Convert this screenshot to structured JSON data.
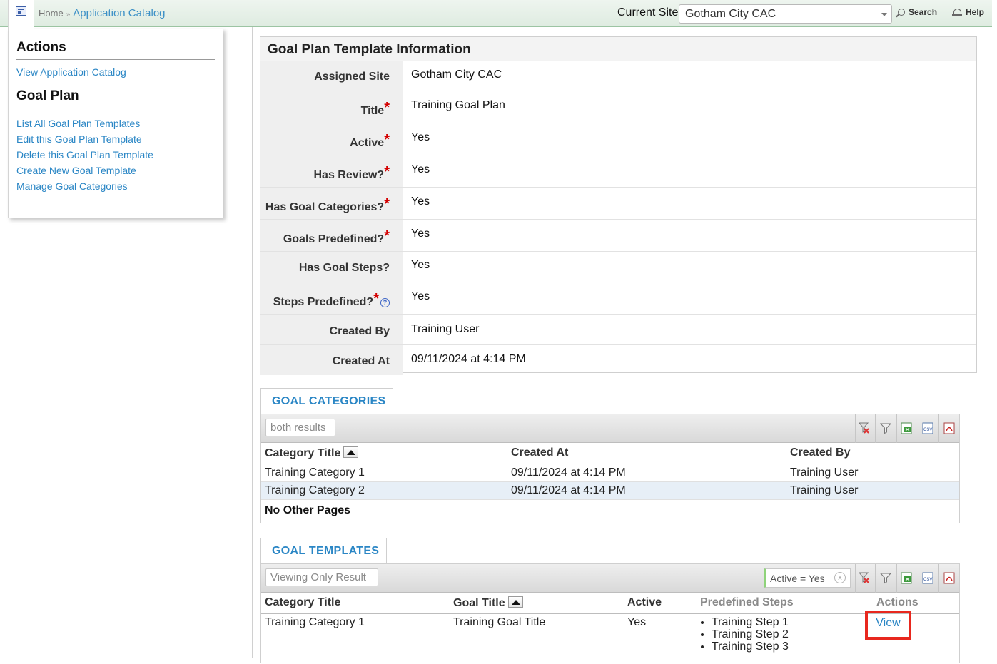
{
  "breadcrumb": {
    "home": "Home",
    "current": "Application Catalog"
  },
  "header": {
    "site_label": "Current Site",
    "site_value": "Gotham City CAC",
    "search": "Search",
    "help": "Help"
  },
  "sidebar": {
    "actions_title": "Actions",
    "actions": [
      "View Application Catalog"
    ],
    "goal_plan_title": "Goal Plan",
    "goal_plan_links": [
      "List All Goal Plan Templates",
      "Edit this Goal Plan Template",
      "Delete this Goal Plan Template",
      "Create New Goal Template",
      "Manage Goal Categories"
    ]
  },
  "info": {
    "title": "Goal Plan Template Information",
    "rows": [
      {
        "label": "Assigned Site",
        "value": "Gotham City CAC",
        "required": false
      },
      {
        "label": "Title",
        "value": "Training Goal Plan",
        "required": true
      },
      {
        "label": "Active",
        "value": "Yes",
        "required": true
      },
      {
        "label": "Has Review?",
        "value": "Yes",
        "required": true
      },
      {
        "label": "Has Goal Categories?",
        "value": "Yes",
        "required": true
      },
      {
        "label": "Goals Predefined?",
        "value": "Yes",
        "required": true
      },
      {
        "label": "Has Goal Steps?",
        "value": "Yes",
        "required": false
      },
      {
        "label": "Steps Predefined?",
        "value": "Yes",
        "required": true
      },
      {
        "label": "Created By",
        "value": "Training User",
        "required": false
      },
      {
        "label": "Created At",
        "value": "09/11/2024 at 4:14 PM",
        "required": false
      }
    ],
    "required_mark": "*",
    "help_glyph": "?"
  },
  "categories": {
    "tab": "GOAL CATEGORIES",
    "chip": "both results",
    "headers": [
      "Category Title",
      "Created At",
      "Created By"
    ],
    "rows": [
      [
        "Training Category 1",
        "09/11/2024 at 4:14 PM",
        "Training User"
      ],
      [
        "Training Category 2",
        "09/11/2024 at 4:14 PM",
        "Training User"
      ]
    ],
    "footer": "No Other Pages"
  },
  "templates": {
    "tab": "GOAL TEMPLATES",
    "chip": "Viewing Only Result",
    "filter": "Active = Yes",
    "filter_clear": "x",
    "headers": [
      "Category Title",
      "Goal Title",
      "Active",
      "Predefined Steps",
      "Actions"
    ],
    "rows": [
      {
        "category": "Training Category 1",
        "goal": "Training Goal Title",
        "active": "Yes",
        "steps": [
          "Training Step 1",
          "Training Step 2",
          "Training Step 3"
        ],
        "action": "View"
      }
    ]
  },
  "toolbar_icons": [
    "clear-filter-icon",
    "filter-icon",
    "excel-icon",
    "csv-icon",
    "pdf-icon"
  ],
  "colors": {
    "link": "#2a86c5",
    "required": "#d40000",
    "highlight": "#e8281e",
    "alt_row": "#e7eff7"
  }
}
